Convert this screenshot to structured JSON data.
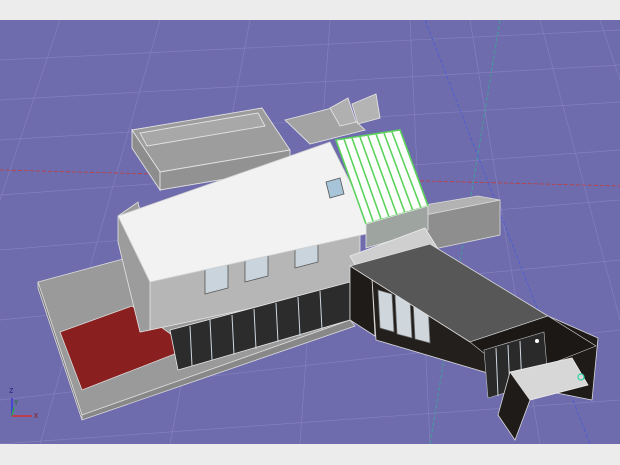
{
  "viewport": {
    "background_color": "#6e6cac",
    "grid_color": "#8a88c4",
    "x_axis_color": "#c23c3c",
    "y_axis_color": "#3aa89a",
    "z_axis_color": "#4a5bd6"
  },
  "axis_gizmo": {
    "z_label": "Z",
    "y_label": "Y",
    "x_label": "X"
  },
  "colors": {
    "white_roof": "#f2f2f2",
    "wall_gray": "#a9a9a9",
    "dark_wall": "#1f1b19",
    "dark_roof": "#575757",
    "red_deck": "#8a1f1f",
    "selection_green": "#5dd35d",
    "glass": "#c9d4dc"
  }
}
